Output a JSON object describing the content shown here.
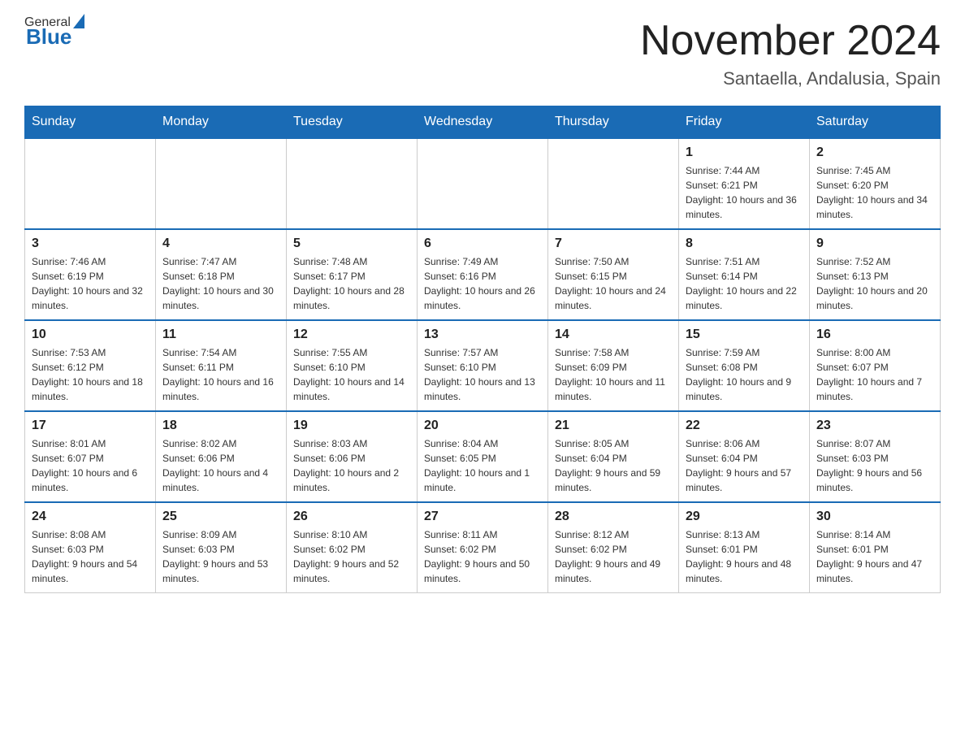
{
  "header": {
    "month_title": "November 2024",
    "location": "Santaella, Andalusia, Spain",
    "logo_general": "General",
    "logo_blue": "Blue"
  },
  "days_of_week": [
    "Sunday",
    "Monday",
    "Tuesday",
    "Wednesday",
    "Thursday",
    "Friday",
    "Saturday"
  ],
  "weeks": [
    [
      {
        "day": "",
        "sunrise": "",
        "sunset": "",
        "daylight": ""
      },
      {
        "day": "",
        "sunrise": "",
        "sunset": "",
        "daylight": ""
      },
      {
        "day": "",
        "sunrise": "",
        "sunset": "",
        "daylight": ""
      },
      {
        "day": "",
        "sunrise": "",
        "sunset": "",
        "daylight": ""
      },
      {
        "day": "",
        "sunrise": "",
        "sunset": "",
        "daylight": ""
      },
      {
        "day": "1",
        "sunrise": "Sunrise: 7:44 AM",
        "sunset": "Sunset: 6:21 PM",
        "daylight": "Daylight: 10 hours and 36 minutes."
      },
      {
        "day": "2",
        "sunrise": "Sunrise: 7:45 AM",
        "sunset": "Sunset: 6:20 PM",
        "daylight": "Daylight: 10 hours and 34 minutes."
      }
    ],
    [
      {
        "day": "3",
        "sunrise": "Sunrise: 7:46 AM",
        "sunset": "Sunset: 6:19 PM",
        "daylight": "Daylight: 10 hours and 32 minutes."
      },
      {
        "day": "4",
        "sunrise": "Sunrise: 7:47 AM",
        "sunset": "Sunset: 6:18 PM",
        "daylight": "Daylight: 10 hours and 30 minutes."
      },
      {
        "day": "5",
        "sunrise": "Sunrise: 7:48 AM",
        "sunset": "Sunset: 6:17 PM",
        "daylight": "Daylight: 10 hours and 28 minutes."
      },
      {
        "day": "6",
        "sunrise": "Sunrise: 7:49 AM",
        "sunset": "Sunset: 6:16 PM",
        "daylight": "Daylight: 10 hours and 26 minutes."
      },
      {
        "day": "7",
        "sunrise": "Sunrise: 7:50 AM",
        "sunset": "Sunset: 6:15 PM",
        "daylight": "Daylight: 10 hours and 24 minutes."
      },
      {
        "day": "8",
        "sunrise": "Sunrise: 7:51 AM",
        "sunset": "Sunset: 6:14 PM",
        "daylight": "Daylight: 10 hours and 22 minutes."
      },
      {
        "day": "9",
        "sunrise": "Sunrise: 7:52 AM",
        "sunset": "Sunset: 6:13 PM",
        "daylight": "Daylight: 10 hours and 20 minutes."
      }
    ],
    [
      {
        "day": "10",
        "sunrise": "Sunrise: 7:53 AM",
        "sunset": "Sunset: 6:12 PM",
        "daylight": "Daylight: 10 hours and 18 minutes."
      },
      {
        "day": "11",
        "sunrise": "Sunrise: 7:54 AM",
        "sunset": "Sunset: 6:11 PM",
        "daylight": "Daylight: 10 hours and 16 minutes."
      },
      {
        "day": "12",
        "sunrise": "Sunrise: 7:55 AM",
        "sunset": "Sunset: 6:10 PM",
        "daylight": "Daylight: 10 hours and 14 minutes."
      },
      {
        "day": "13",
        "sunrise": "Sunrise: 7:57 AM",
        "sunset": "Sunset: 6:10 PM",
        "daylight": "Daylight: 10 hours and 13 minutes."
      },
      {
        "day": "14",
        "sunrise": "Sunrise: 7:58 AM",
        "sunset": "Sunset: 6:09 PM",
        "daylight": "Daylight: 10 hours and 11 minutes."
      },
      {
        "day": "15",
        "sunrise": "Sunrise: 7:59 AM",
        "sunset": "Sunset: 6:08 PM",
        "daylight": "Daylight: 10 hours and 9 minutes."
      },
      {
        "day": "16",
        "sunrise": "Sunrise: 8:00 AM",
        "sunset": "Sunset: 6:07 PM",
        "daylight": "Daylight: 10 hours and 7 minutes."
      }
    ],
    [
      {
        "day": "17",
        "sunrise": "Sunrise: 8:01 AM",
        "sunset": "Sunset: 6:07 PM",
        "daylight": "Daylight: 10 hours and 6 minutes."
      },
      {
        "day": "18",
        "sunrise": "Sunrise: 8:02 AM",
        "sunset": "Sunset: 6:06 PM",
        "daylight": "Daylight: 10 hours and 4 minutes."
      },
      {
        "day": "19",
        "sunrise": "Sunrise: 8:03 AM",
        "sunset": "Sunset: 6:06 PM",
        "daylight": "Daylight: 10 hours and 2 minutes."
      },
      {
        "day": "20",
        "sunrise": "Sunrise: 8:04 AM",
        "sunset": "Sunset: 6:05 PM",
        "daylight": "Daylight: 10 hours and 1 minute."
      },
      {
        "day": "21",
        "sunrise": "Sunrise: 8:05 AM",
        "sunset": "Sunset: 6:04 PM",
        "daylight": "Daylight: 9 hours and 59 minutes."
      },
      {
        "day": "22",
        "sunrise": "Sunrise: 8:06 AM",
        "sunset": "Sunset: 6:04 PM",
        "daylight": "Daylight: 9 hours and 57 minutes."
      },
      {
        "day": "23",
        "sunrise": "Sunrise: 8:07 AM",
        "sunset": "Sunset: 6:03 PM",
        "daylight": "Daylight: 9 hours and 56 minutes."
      }
    ],
    [
      {
        "day": "24",
        "sunrise": "Sunrise: 8:08 AM",
        "sunset": "Sunset: 6:03 PM",
        "daylight": "Daylight: 9 hours and 54 minutes."
      },
      {
        "day": "25",
        "sunrise": "Sunrise: 8:09 AM",
        "sunset": "Sunset: 6:03 PM",
        "daylight": "Daylight: 9 hours and 53 minutes."
      },
      {
        "day": "26",
        "sunrise": "Sunrise: 8:10 AM",
        "sunset": "Sunset: 6:02 PM",
        "daylight": "Daylight: 9 hours and 52 minutes."
      },
      {
        "day": "27",
        "sunrise": "Sunrise: 8:11 AM",
        "sunset": "Sunset: 6:02 PM",
        "daylight": "Daylight: 9 hours and 50 minutes."
      },
      {
        "day": "28",
        "sunrise": "Sunrise: 8:12 AM",
        "sunset": "Sunset: 6:02 PM",
        "daylight": "Daylight: 9 hours and 49 minutes."
      },
      {
        "day": "29",
        "sunrise": "Sunrise: 8:13 AM",
        "sunset": "Sunset: 6:01 PM",
        "daylight": "Daylight: 9 hours and 48 minutes."
      },
      {
        "day": "30",
        "sunrise": "Sunrise: 8:14 AM",
        "sunset": "Sunset: 6:01 PM",
        "daylight": "Daylight: 9 hours and 47 minutes."
      }
    ]
  ]
}
